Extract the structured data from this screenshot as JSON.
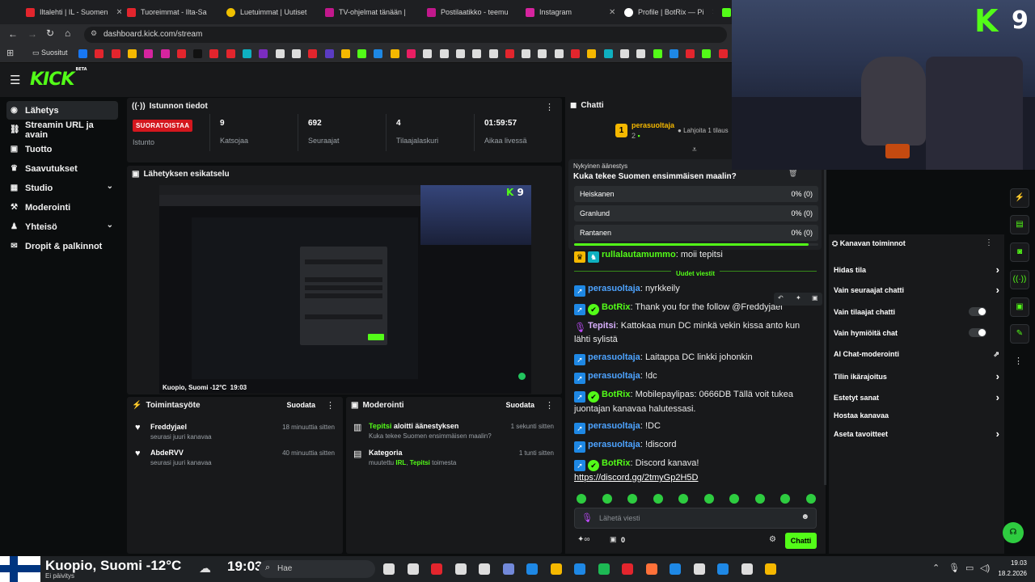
{
  "browser": {
    "tabs": [
      {
        "label": "Iltalehti | IL - Suomen",
        "color": "#e3252d"
      },
      {
        "label": "Tuoreimmat - Ilta-Sa",
        "color": "#e3252d"
      },
      {
        "label": "Luetuimmat | Uutiset",
        "color": "#f0c000"
      },
      {
        "label": "TV-ohjelmat tänään |",
        "color": "#c2188c"
      },
      {
        "label": "Postilaatikko - teemu",
        "color": "#c2188c"
      },
      {
        "label": "Instagram",
        "color": "#d6249f"
      },
      {
        "label": "Profile | BotRix — Pi",
        "color": "#ffffff"
      }
    ],
    "url": "dashboard.kick.com/stream",
    "bookmarks_label": "Suositut"
  },
  "app": {
    "logo": "KICK",
    "logo_sup": "BETA"
  },
  "sidebar": {
    "items": [
      {
        "label": "Lähetys",
        "icon": "broadcast-icon",
        "glyph": "◉"
      },
      {
        "label": "Streamin URL ja avain",
        "icon": "link-icon",
        "glyph": "⛓"
      },
      {
        "label": "Tuotto",
        "icon": "revenue-icon",
        "glyph": "▣"
      },
      {
        "label": "Saavutukset",
        "icon": "trophy-icon",
        "glyph": "♛"
      },
      {
        "label": "Studio",
        "icon": "studio-icon",
        "glyph": "▦"
      },
      {
        "label": "Moderointi",
        "icon": "hammer-icon",
        "glyph": "⚒"
      },
      {
        "label": "Yhteisö",
        "icon": "community-icon",
        "glyph": "♟"
      },
      {
        "label": "Dropit & palkinnot",
        "icon": "gift-icon",
        "glyph": "✉"
      }
    ]
  },
  "session": {
    "title": "Istunnon tiedot",
    "live_badge": "SUORATOISTAA",
    "live_label": "Istunto",
    "stats": [
      {
        "value": "9",
        "label": "Katsojaa"
      },
      {
        "value": "692",
        "label": "Seuraajat"
      },
      {
        "value": "4",
        "label": "Tilaajalaskuri"
      },
      {
        "value": "01:59:57",
        "label": "Aikaa livessä"
      }
    ]
  },
  "preview": {
    "title": "Lähetyksen esikatselu",
    "overlay_location": "Kuopio, Suomi -12°C",
    "overlay_time": "19:03"
  },
  "activity": {
    "title": "Toimintasyöte",
    "filter": "Suodata",
    "items": [
      {
        "name": "Freddyjael",
        "sub": "seurasi juuri kanavaa",
        "time": "18 minuuttia sitten"
      },
      {
        "name": "AbdeRVV",
        "sub": "seurasi juuri kanavaa",
        "time": "40 minuuttia sitten"
      }
    ]
  },
  "moderation": {
    "title": "Moderointi",
    "filter": "Suodata",
    "items": [
      {
        "name": "Tepitsi",
        "action": "aloitti äänestyksen",
        "sub": "Kuka tekee Suomen ensimmäisen maalin?",
        "time": "1 sekunti sitten"
      },
      {
        "name": "Kategoria",
        "action": "",
        "sub_prefix": "muutettu",
        "sub_cat": "IRL",
        "sub_by": "Tepitsi",
        "sub_suffix": "toimesta",
        "time": "1 tunti sitten"
      }
    ]
  },
  "chat": {
    "title": "Chatti",
    "top_gifter": {
      "rank": "1",
      "name": "perasuoltaja",
      "count": "2"
    },
    "gift_label": "Lahjoita 1 tilaus",
    "poll": {
      "label": "Nykyinen äänestys",
      "question": "Kuka tekee Suomen ensimmäisen maalin?",
      "options": [
        {
          "name": "Heiskanen",
          "result": "0% (0)"
        },
        {
          "name": "Granlund",
          "result": "0% (0)"
        },
        {
          "name": "Rantanen",
          "result": "0% (0)"
        }
      ],
      "progress": 0.96
    },
    "partial_message": {
      "user": "rullalautamummo",
      "text": "moii tepitsi"
    },
    "new_messages_label": "Uudet viestit",
    "messages": [
      {
        "user": "perasuoltaja",
        "text": "nyrkkeily"
      },
      {
        "user": "BotRix",
        "text": "Thank you for the follow @Freddyjael"
      },
      {
        "user": "Tepitsi",
        "text": "Kattokaa mun DC minkä vekin kissa anto kun lähti sylistä"
      },
      {
        "user": "perasuoltaja",
        "text": "Laitappa DC linkki johonkin"
      },
      {
        "user": "perasuoltaja",
        "text": "!dc"
      },
      {
        "user": "BotRix",
        "text": "Mobilepaylipas: 0666DB Tällä voit tukea juontajan kanavaa halutessasi."
      },
      {
        "user": "perasuoltaja",
        "text": "!DC"
      },
      {
        "user": "perasuoltaja",
        "text": "!discord"
      },
      {
        "user": "BotRix",
        "text": "Discord kanava!",
        "link": "https://discord.gg/2tmyGp2H5D"
      }
    ],
    "input_placeholder": "Lähetä viesti",
    "points": "0",
    "send_label": "Chatti"
  },
  "channel_actions": {
    "title": "Kanavan toiminnot",
    "items": [
      {
        "label": "Hidas tila",
        "control": "arrow"
      },
      {
        "label": "Vain seuraajat chatti",
        "control": "arrow"
      },
      {
        "label": "Vain tilaajat chatti",
        "control": "toggle"
      },
      {
        "label": "Vain hymiöitä chat",
        "control": "toggle"
      },
      {
        "label": "AI Chat-moderointi",
        "control": "external"
      },
      {
        "label": "Tilin ikärajoitus",
        "control": "arrow"
      },
      {
        "label": "Estetyt sanat",
        "control": "arrow"
      },
      {
        "label": "Hostaa kanavaa",
        "control": "none"
      },
      {
        "label": "Aseta tavoitteet",
        "control": "arrow"
      }
    ]
  },
  "webcam": {
    "overlay_number": "9"
  },
  "taskbar": {
    "weather": "Kuopio, Suomi -12°C",
    "weather_sub": "Ei päivitys",
    "time_big": "19:03",
    "search_placeholder": "Hae",
    "clock_time": "19.03",
    "clock_date": "18.2.2026"
  }
}
